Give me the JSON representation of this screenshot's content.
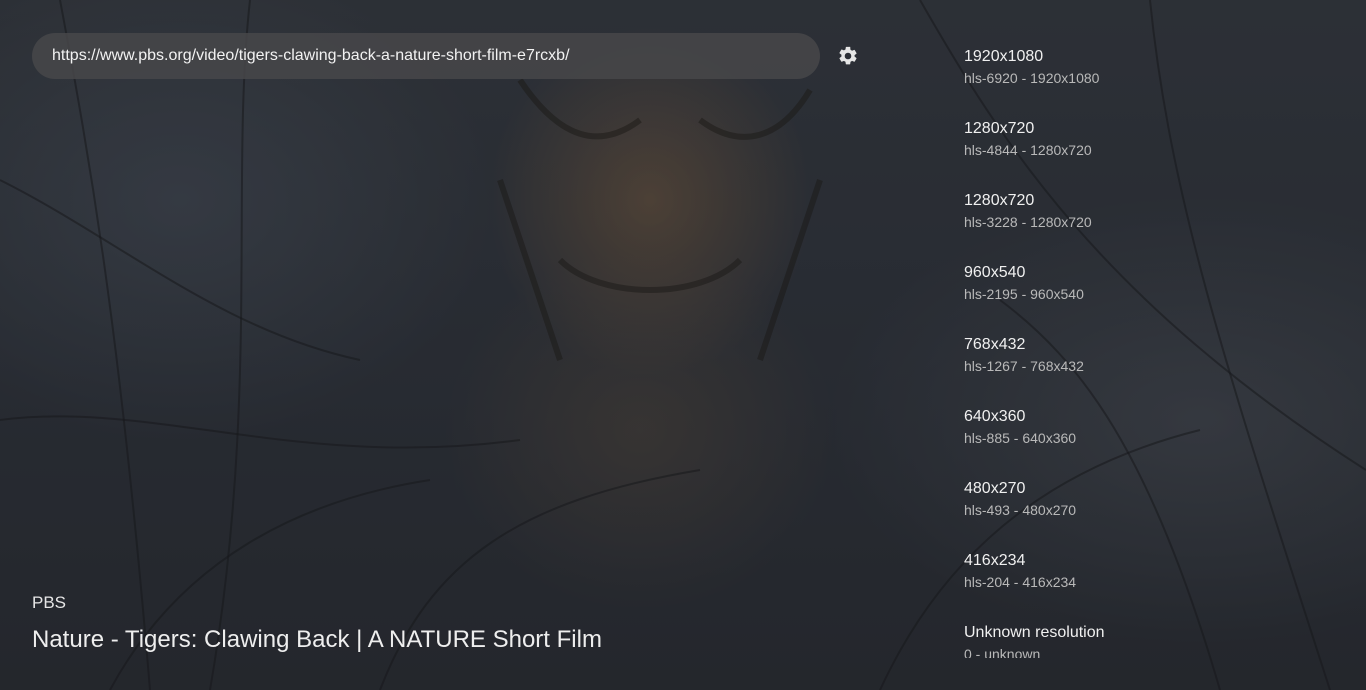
{
  "url_bar": {
    "value": "https://www.pbs.org/video/tigers-clawing-back-a-nature-short-film-e7rcxb/"
  },
  "settings": {
    "icon": "gear-icon"
  },
  "resolutions": [
    {
      "title": "1920x1080",
      "detail": "hls-6920 - 1920x1080"
    },
    {
      "title": "1280x720",
      "detail": "hls-4844 - 1280x720"
    },
    {
      "title": "1280x720",
      "detail": "hls-3228 - 1280x720"
    },
    {
      "title": "960x540",
      "detail": "hls-2195 - 960x540"
    },
    {
      "title": "768x432",
      "detail": "hls-1267 - 768x432"
    },
    {
      "title": "640x360",
      "detail": "hls-885 - 640x360"
    },
    {
      "title": "480x270",
      "detail": "hls-493 - 480x270"
    },
    {
      "title": "416x234",
      "detail": "hls-204 - 416x234"
    },
    {
      "title": "Unknown resolution",
      "detail": "0 - unknown"
    }
  ],
  "video": {
    "channel": "PBS",
    "title": "Nature - Tigers: Clawing Back | A NATURE Short Film"
  }
}
